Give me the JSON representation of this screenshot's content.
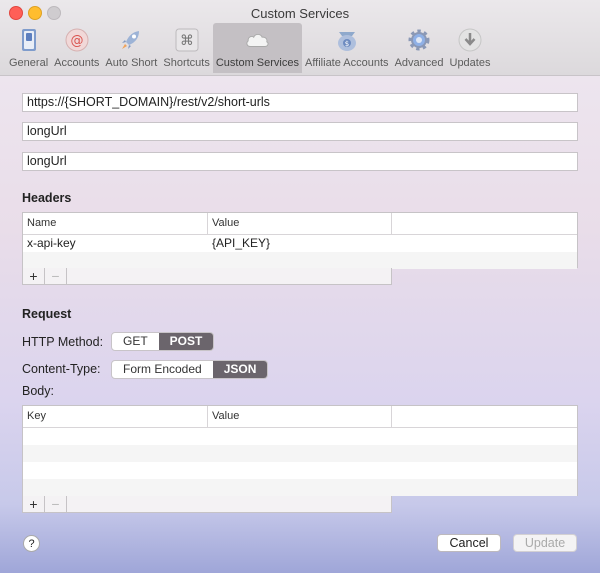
{
  "window": {
    "title": "Custom Services"
  },
  "toolbar": {
    "tabs": [
      {
        "label": "General",
        "icon": "switch-icon"
      },
      {
        "label": "Accounts",
        "icon": "at-icon"
      },
      {
        "label": "Auto Short",
        "icon": "rocket-icon"
      },
      {
        "label": "Shortcuts",
        "icon": "command-icon"
      },
      {
        "label": "Custom Services",
        "icon": "cloud-icon",
        "active": true
      },
      {
        "label": "Affiliate Accounts",
        "icon": "money-bag-icon"
      },
      {
        "label": "Advanced",
        "icon": "gear-icon"
      },
      {
        "label": "Updates",
        "icon": "download-icon"
      }
    ]
  },
  "fields": {
    "url": "https://{SHORT_DOMAIN}/rest/v2/short-urls",
    "field2": "longUrl",
    "field3": "longUrl"
  },
  "headers": {
    "title": "Headers",
    "columns": [
      "Name",
      "Value"
    ],
    "rows": [
      {
        "name": "x-api-key",
        "value": "{API_KEY}"
      }
    ],
    "add_label": "+",
    "remove_label": "−"
  },
  "request": {
    "title": "Request",
    "http_method_label": "HTTP Method:",
    "http_methods": [
      "GET",
      "POST"
    ],
    "http_selected": "POST",
    "content_type_label": "Content-Type:",
    "content_types": [
      "Form Encoded",
      "JSON"
    ],
    "content_type_selected": "JSON",
    "body_label": "Body:",
    "body_columns": [
      "Key",
      "Value"
    ],
    "add_label": "+",
    "remove_label": "−"
  },
  "footer": {
    "help_label": "?",
    "cancel_label": "Cancel",
    "update_label": "Update"
  },
  "colors": {
    "selected_segment": "#6b656c",
    "close": "#ff5f57",
    "minimize": "#ffbd2e"
  }
}
